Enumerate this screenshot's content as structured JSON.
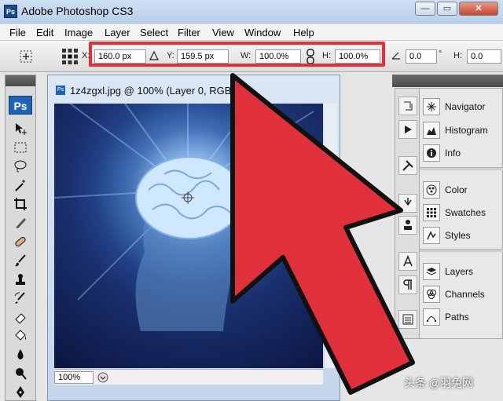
{
  "window": {
    "title": "Adobe Photoshop CS3",
    "app_icon": "Ps"
  },
  "window_buttons": {
    "minimize": "—",
    "restore": "▭",
    "close": "✕"
  },
  "menu": [
    "File",
    "Edit",
    "Image",
    "Layer",
    "Select",
    "Filter",
    "View",
    "Window",
    "Help"
  ],
  "options": {
    "x_label": "X:",
    "x_value": "160.0 px",
    "y_label": "Y:",
    "y_value": "159.5 px",
    "w_label": "W:",
    "w_value": "100.0%",
    "h_label": "H:",
    "h_value": "100.0%",
    "angle_value": "0.0",
    "degree": "°",
    "hskew_label": "H:",
    "hskew_value": "0.0"
  },
  "toolbox": {
    "logo": "Ps"
  },
  "document": {
    "title": "1z4zgxl.jpg @ 100% (Layer 0, RGB/8)",
    "icon": "Ps",
    "zoom": "100%"
  },
  "panels": {
    "group1": [
      "Navigator",
      "Histogram",
      "Info"
    ],
    "group2": [
      "Color",
      "Swatches",
      "Styles"
    ],
    "group3": [
      "Layers",
      "Channels",
      "Paths"
    ]
  },
  "watermark": "头条 @羽兔网",
  "colors": {
    "highlight": "#e0303b",
    "arrow": "#e0303b",
    "accent": "#1f63b4"
  }
}
